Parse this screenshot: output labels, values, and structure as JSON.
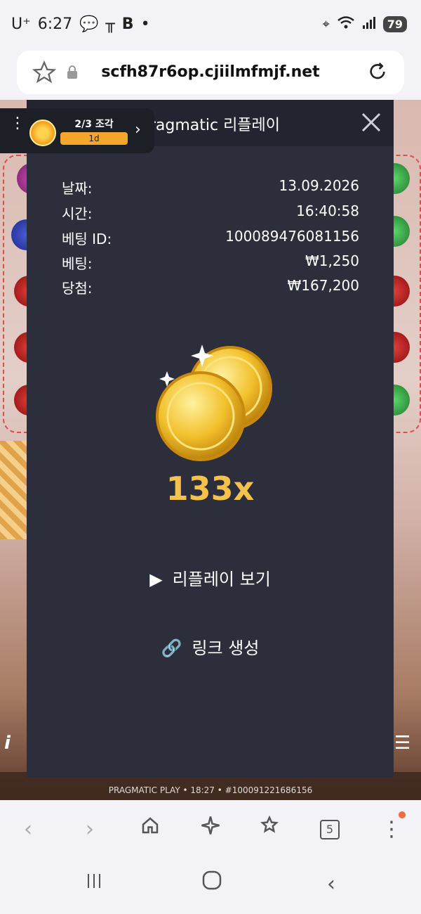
{
  "status": {
    "carrier": "U⁺",
    "time": "6:27",
    "battery": "79"
  },
  "browser": {
    "url": "scfh87r6op.cjiilmfmjf.net",
    "tab_count": "5"
  },
  "badge": {
    "progress": "2/3 조각",
    "timer": "1d"
  },
  "modal": {
    "title": "Pragmatic 리플레이",
    "rows": [
      {
        "label": "날짜:",
        "value": "13.09.2026"
      },
      {
        "label": "시간:",
        "value": "16:40:58"
      },
      {
        "label": "베팅 ID:",
        "value": "100089476081156"
      },
      {
        "label": "베팅:",
        "value": "₩1,250"
      },
      {
        "label": "당첨:",
        "value": "₩167,200"
      }
    ],
    "multiplier": "133x",
    "replay_label": "리플레이 보기",
    "link_label": "링크 생성"
  },
  "game_footer": "PRAGMATIC PLAY • 18:27 • #100091221686156",
  "colors": {
    "modal_bg": "#2d2e3b",
    "accent_gold": "#f4c24a"
  }
}
